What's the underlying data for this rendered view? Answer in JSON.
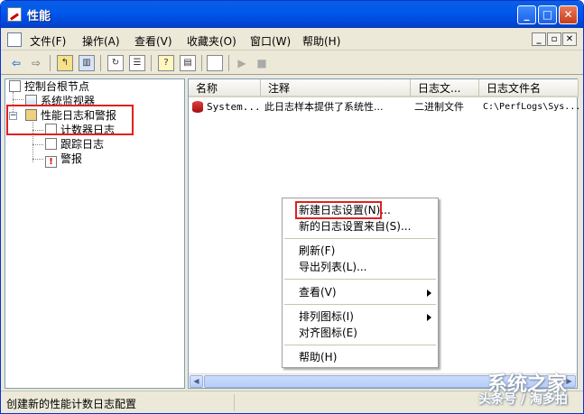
{
  "window": {
    "title": "性能"
  },
  "title_buttons": {
    "minimize": "_",
    "maximize": "□",
    "close": "✕"
  },
  "menubar": {
    "items": [
      "文件(F)",
      "操作(A)",
      "查看(V)",
      "收藏夹(O)",
      "窗口(W)",
      "帮助(H)"
    ]
  },
  "mdi_buttons": {
    "minimize": "_",
    "restore": "▫",
    "close": "✕"
  },
  "tree": {
    "root": "控制台根节点",
    "system_monitor": "系统监视器",
    "perf_logs": "性能日志和警报",
    "counter_logs": "计数器日志",
    "trace_logs": "跟踪日志",
    "alerts": "警报"
  },
  "list": {
    "columns": [
      "名称",
      "注释",
      "日志文...",
      "日志文件名"
    ],
    "rows": [
      {
        "name": "System...",
        "comment": "此日志样本提供了系统性...",
        "type": "二进制文件",
        "file": "C:\\PerfLogs\\Sys..."
      }
    ]
  },
  "context_menu": {
    "new_settings": "新建日志设置(N)...",
    "new_settings_from": "新的日志设置来自(S)...",
    "refresh": "刷新(F)",
    "export_list": "导出列表(L)...",
    "view": "查看(V)",
    "arrange_icons": "排列图标(I)",
    "line_up_icons": "对齐图标(E)",
    "help": "帮助(H)"
  },
  "statusbar": {
    "text": "创建新的性能计数日志配置"
  },
  "watermark": {
    "line1": "系统之家",
    "line2": "头条号 / 淘多拍"
  },
  "colors": {
    "title_blue": "#0058ee",
    "highlight_red": "#e0201e",
    "xp_face": "#ece9d8"
  }
}
